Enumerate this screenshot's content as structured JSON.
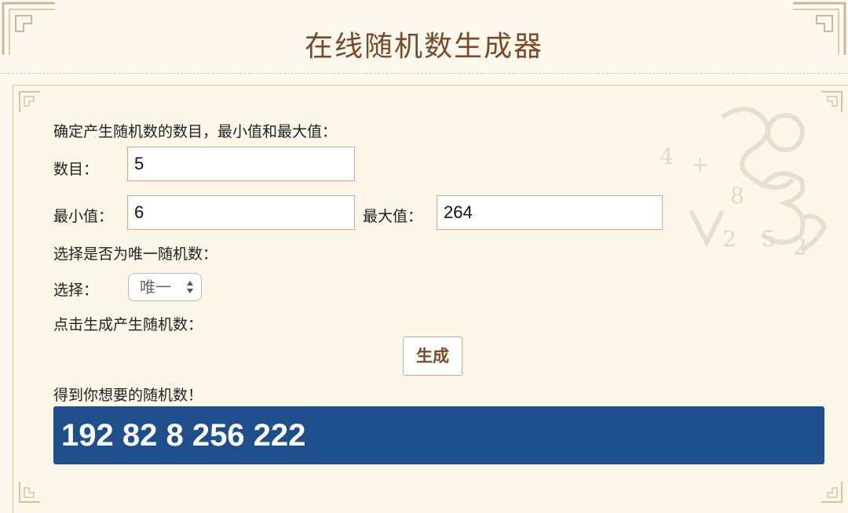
{
  "app": {
    "title": "在线随机数生成器"
  },
  "form": {
    "intro_label": "确定产生随机数的数目，最小值和最大值：",
    "count_label": "数目：",
    "count_value": "5",
    "min_label": "最小值：",
    "min_value": "6",
    "max_label": "最大值：",
    "max_value": "264",
    "unique_intro_label": "选择是否为唯一随机数：",
    "select_label": "选择：",
    "select_value": "唯一",
    "generate_intro_label": "点击生成产生随机数：",
    "generate_button": "生成",
    "result_label": "得到你想要的随机数！",
    "result_value": "192 82 8 256 222"
  },
  "colors": {
    "title": "#7a4a28",
    "background": "#fdf8ee",
    "result_bg": "#1e4e8c",
    "input_border": "#d1a98a"
  },
  "icons": [
    "corner-ornament-icon",
    "numbers-decoration-icon",
    "select-arrows-icon"
  ]
}
